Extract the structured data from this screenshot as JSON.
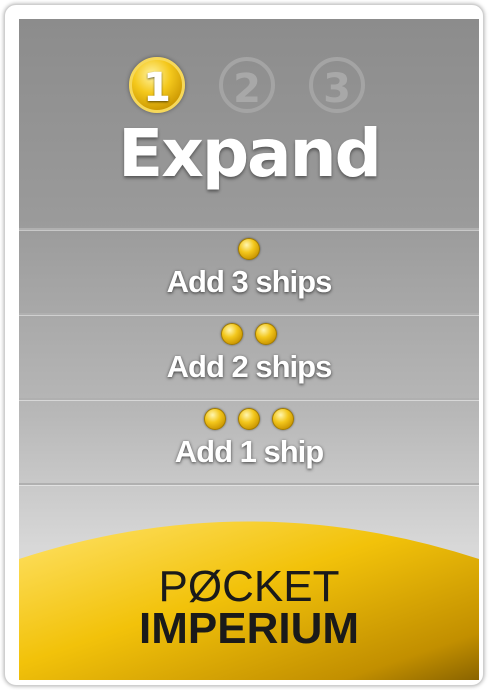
{
  "steps": [
    {
      "label": "1",
      "active": true
    },
    {
      "label": "2",
      "active": false
    },
    {
      "label": "3",
      "active": false
    }
  ],
  "title": "Expand",
  "options": [
    {
      "dots": 1,
      "label": "Add 3 ships"
    },
    {
      "dots": 2,
      "label": "Add 2 ships"
    },
    {
      "dots": 3,
      "label": "Add 1 ship"
    }
  ],
  "logo": {
    "line1": "PØCKET",
    "line2": "IMPERIUM"
  },
  "colors": {
    "gold": "#f3c71c",
    "panel_top": "#8c8c8c",
    "panel_bottom": "#e6e6e6",
    "text": "#ffffff"
  }
}
